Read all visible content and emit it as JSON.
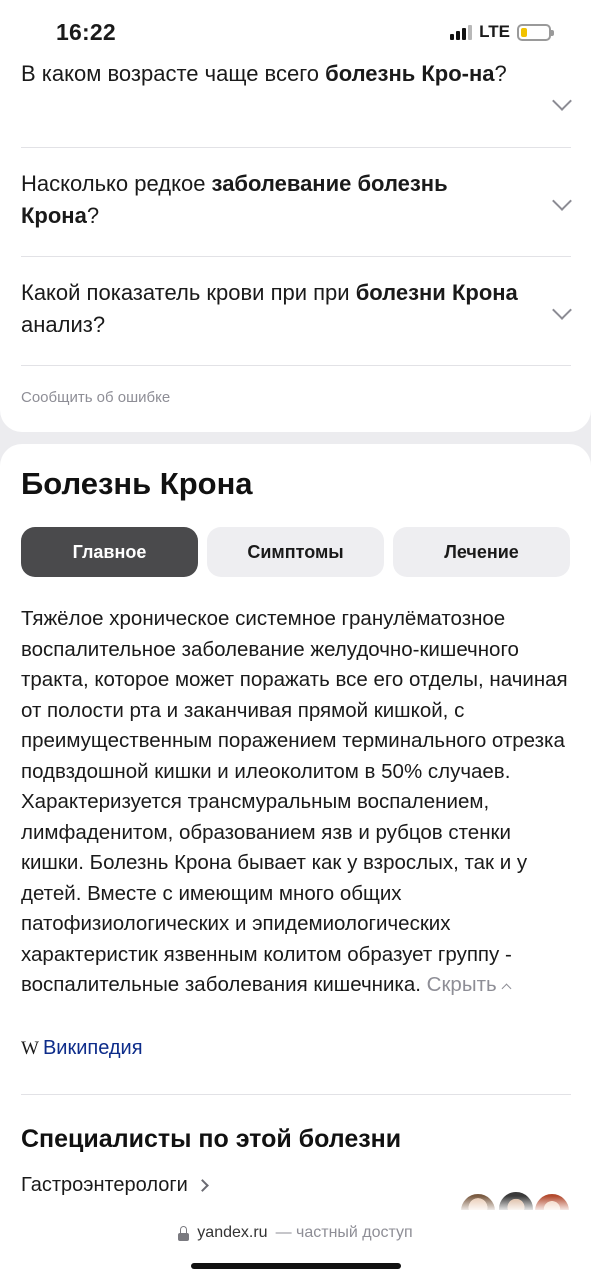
{
  "status_bar": {
    "time": "16:22",
    "network": "LTE"
  },
  "faq": {
    "items": [
      {
        "plain_before": "В каком возрасте чаще всего ",
        "bold": "болезнь Кро-на",
        "plain_after": "?"
      },
      {
        "plain_before": "Насколько редкое ",
        "bold": "заболевание болезнь Крона",
        "plain_after": "?"
      },
      {
        "plain_before": "Какой показатель крови при при ",
        "bold": "болезни Крона",
        "plain_after": " анализ?"
      }
    ],
    "report_label": "Сообщить об ошибке"
  },
  "article": {
    "title": "Болезнь Крона",
    "tabs": [
      {
        "label": "Главное",
        "active": true
      },
      {
        "label": "Симптомы",
        "active": false
      },
      {
        "label": "Лечение",
        "active": false
      }
    ],
    "description": "Тяжёлое хроническое системное гранулёматозное воспалительное заболевание желудочно-кишечного тракта, которое может поражать все его отделы, начиная от полости рта и заканчивая прямой кишкой, с преимущественным поражением терминального отрезка подвздошной кишки и илеоколитом в 50% случаев. Характеризуется трансмуральным воспалением, лимфаденитом, образованием язв и рубцов стенки кишки. Болезнь Крона бывает как у взрослых, так и у детей. Вместе с имеющим много общих патофизиологических и эпидемиологических характеристик язвенным колитом образует группу - воспалительные заболевания кишечника.",
    "hide_label": "Скрыть",
    "source_icon": "W",
    "source_label": "Википедия"
  },
  "specialists": {
    "title": "Специалисты по этой болезни",
    "first_label": "Гастроэнтерологи"
  },
  "browser": {
    "domain": "yandex.ru",
    "note": "— частный доступ"
  }
}
